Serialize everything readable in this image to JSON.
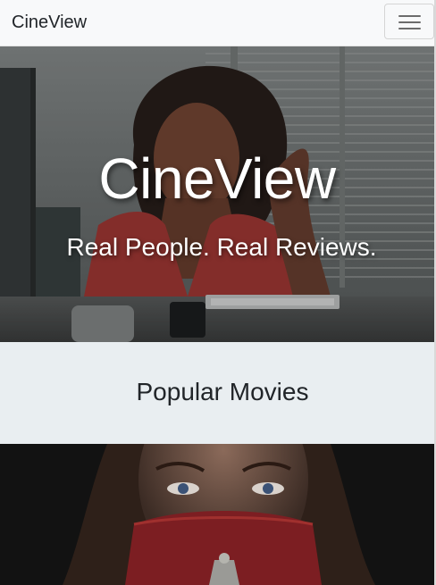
{
  "navbar": {
    "brand": "CineView",
    "toggle_icon": "hamburger-menu-icon"
  },
  "hero": {
    "title": "CineView",
    "tagline": "Real People. Real Reviews."
  },
  "popular": {
    "heading": "Popular Movies"
  },
  "colors": {
    "navbar_bg": "#f8f9fa",
    "section_bg": "#e9eef1",
    "text": "#212529",
    "hero_text": "#ffffff"
  }
}
